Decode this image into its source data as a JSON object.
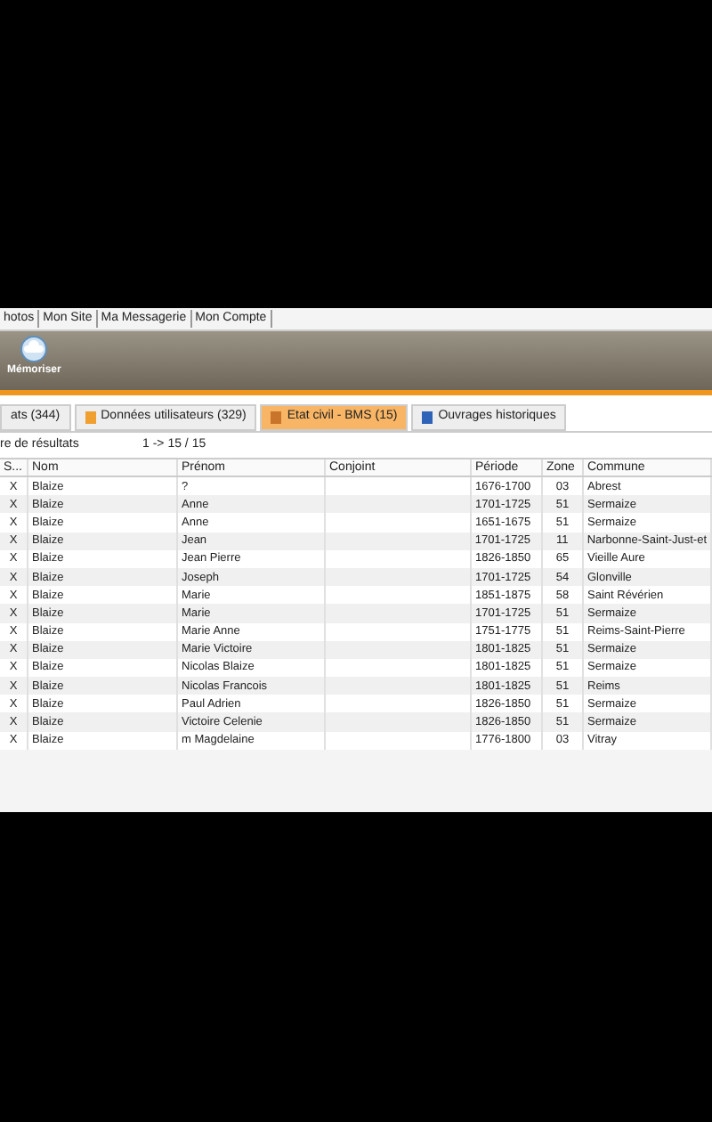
{
  "menu": [
    {
      "label": "hotos"
    },
    {
      "label": "Mon Site"
    },
    {
      "label": "Ma Messagerie"
    },
    {
      "label": "Mon Compte"
    }
  ],
  "toolbar": [
    {
      "label": "Mémoriser"
    }
  ],
  "tabs": [
    {
      "label": "ats (344)",
      "selected": false
    },
    {
      "label": "Données utilisateurs (329)",
      "selected": false
    },
    {
      "label": "Etat civil - BMS (15)",
      "selected": true
    },
    {
      "label": "Ouvrages historiques",
      "selected": false
    }
  ],
  "results": {
    "label": "re de résultats",
    "range": "1 -> 15 / 15"
  },
  "table": {
    "columns": [
      "S...",
      "Nom",
      "Prénom",
      "Conjoint",
      "Période",
      "Zone",
      "Commune"
    ],
    "rows": [
      [
        "X",
        "Blaize",
        "?",
        "",
        "1676-1700",
        "03",
        "Abrest"
      ],
      [
        "X",
        "Blaize",
        "Anne",
        "",
        "1701-1725",
        "51",
        "Sermaize"
      ],
      [
        "X",
        "Blaize",
        "Anne",
        "",
        "1651-1675",
        "51",
        "Sermaize"
      ],
      [
        "X",
        "Blaize",
        "Jean",
        "",
        "1701-1725",
        "11",
        "Narbonne-Saint-Just-et"
      ],
      [
        "X",
        "Blaize",
        "Jean Pierre",
        "",
        "1826-1850",
        "65",
        "Vieille Aure"
      ],
      [
        "X",
        "Blaize",
        "Joseph",
        "",
        "1701-1725",
        "54",
        "Glonville"
      ],
      [
        "X",
        "Blaize",
        "Marie",
        "",
        "1851-1875",
        "58",
        "Saint Révérien"
      ],
      [
        "X",
        "Blaize",
        "Marie",
        "",
        "1701-1725",
        "51",
        "Sermaize"
      ],
      [
        "X",
        "Blaize",
        "Marie Anne",
        "",
        "1751-1775",
        "51",
        "Reims-Saint-Pierre"
      ],
      [
        "X",
        "Blaize",
        "Marie Victoire",
        "",
        "1801-1825",
        "51",
        "Sermaize"
      ],
      [
        "X",
        "Blaize",
        "Nicolas Blaize",
        "",
        "1801-1825",
        "51",
        "Sermaize"
      ],
      [
        "X",
        "Blaize",
        "Nicolas Francois",
        "",
        "1801-1825",
        "51",
        "Reims"
      ],
      [
        "X",
        "Blaize",
        "Paul Adrien",
        "",
        "1826-1850",
        "51",
        "Sermaize"
      ],
      [
        "X",
        "Blaize",
        "Victoire Celenie",
        "",
        "1826-1850",
        "51",
        "Sermaize"
      ],
      [
        "X",
        "Blaize",
        "m Magdelaine",
        "",
        "1776-1800",
        "03",
        "Vitray"
      ]
    ]
  }
}
